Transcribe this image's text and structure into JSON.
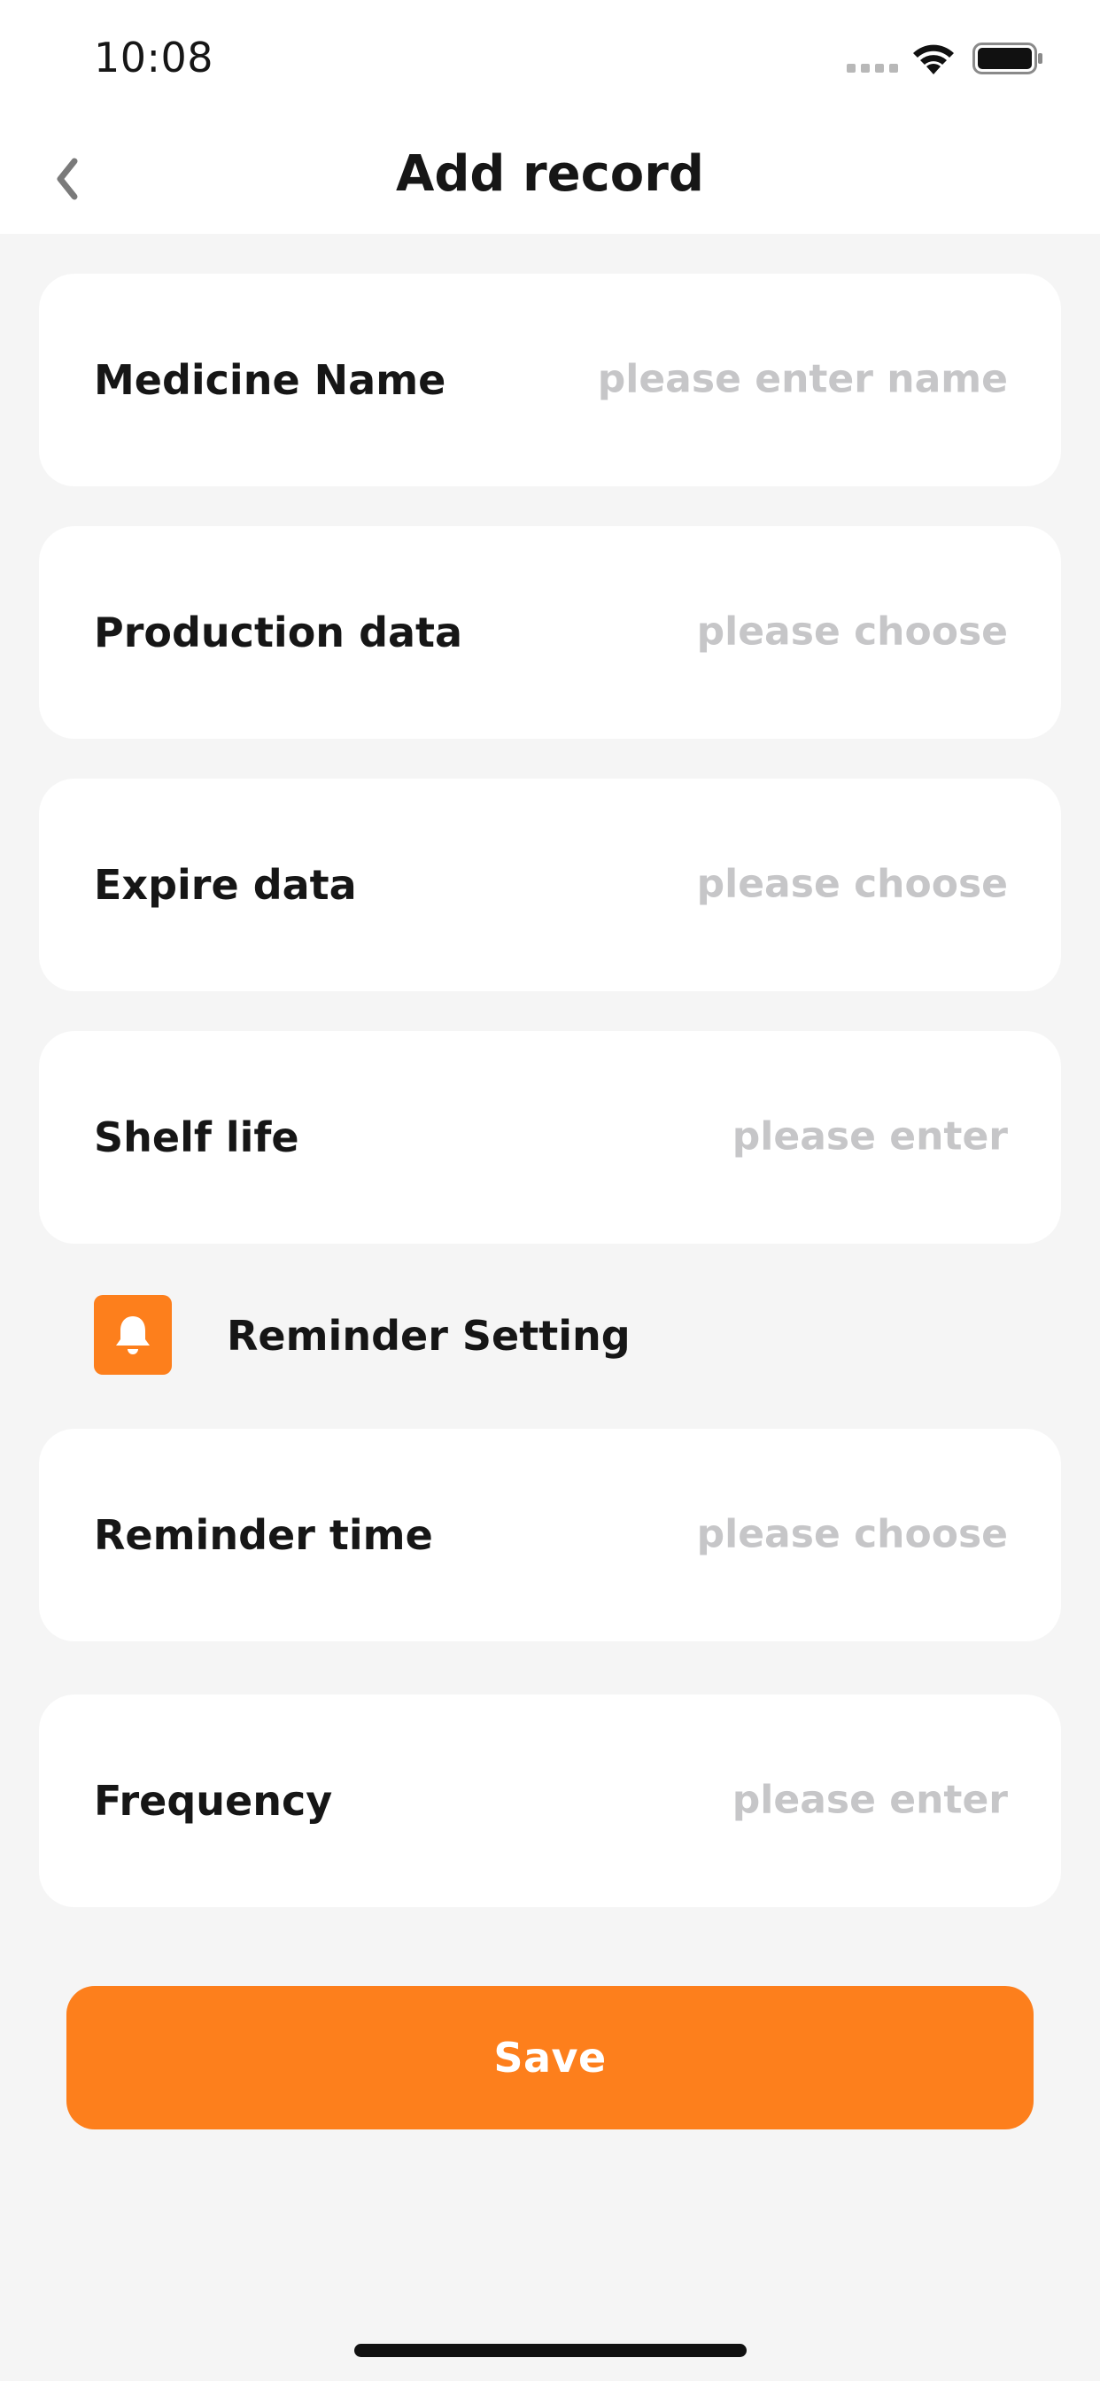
{
  "status_bar": {
    "time": "10:08"
  },
  "header": {
    "title": "Add record"
  },
  "form": {
    "medicine_name": {
      "label": "Medicine Name",
      "value": "",
      "placeholder": "please enter name"
    },
    "production_date": {
      "label": "Production data",
      "value": "",
      "placeholder": "please choose"
    },
    "expire_date": {
      "label": "Expire data",
      "value": "",
      "placeholder": "please choose"
    },
    "shelf_life": {
      "label": "Shelf life",
      "value": "",
      "placeholder": "please enter"
    },
    "reminder_section": {
      "title": "Reminder Setting",
      "icon": "bell-icon"
    },
    "reminder_time": {
      "label": "Reminder time",
      "value": "",
      "placeholder": "please choose"
    },
    "frequency": {
      "label": "Frequency",
      "value": "",
      "placeholder": "please enter"
    }
  },
  "actions": {
    "save_label": "Save"
  },
  "colors": {
    "accent": "#fd7f1c",
    "background": "#f5f5f5",
    "card": "#ffffff",
    "placeholder": "#c6c6c8",
    "text": "#161616"
  },
  "icons": {
    "back": "chevron-left-icon",
    "signal": "cellular-signal-icon",
    "wifi": "wifi-icon",
    "battery": "battery-icon"
  }
}
